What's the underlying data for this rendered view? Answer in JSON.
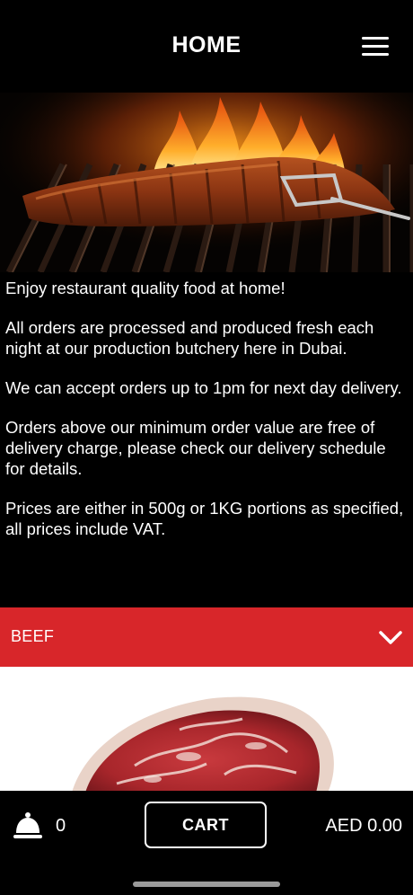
{
  "header": {
    "title": "HOME",
    "menu_icon": "hamburger-menu-icon"
  },
  "hero": {
    "image": "grilled-ribs-on-flaming-grill-with-tongs"
  },
  "intro": {
    "paragraphs": [
      "Enjoy restaurant quality food at home!",
      "All orders are processed and produced fresh each night at our production butchery here in Dubai.",
      "We can accept orders up to 1pm for next day delivery.",
      "Orders above our minimum order value are free of delivery charge, please check our delivery schedule for details.",
      "Prices are either in 500g or 1KG portions as specified, all prices include VAT."
    ]
  },
  "category": {
    "label": "BEEF",
    "icon": "chevron-down-icon",
    "color": "#d8262a"
  },
  "product": {
    "image": "raw-ribeye-steak"
  },
  "footer": {
    "cart_icon": "service-bell-icon",
    "item_count": "0",
    "cart_label": "CART",
    "total": "AED 0.00"
  }
}
